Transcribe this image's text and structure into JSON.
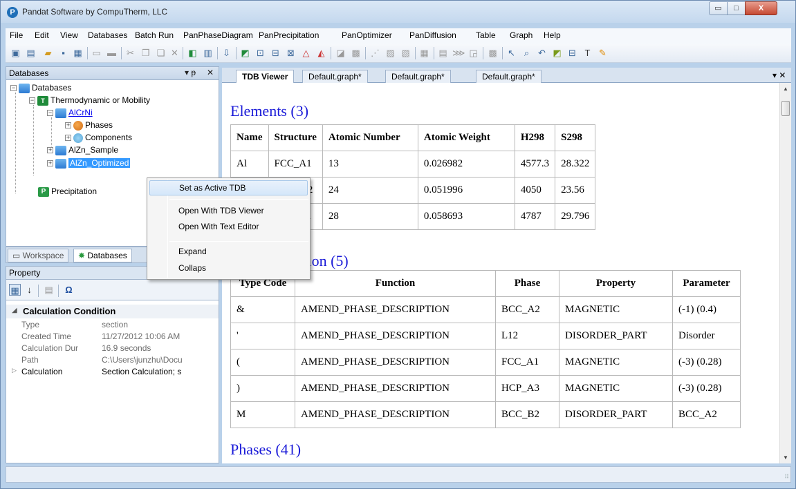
{
  "window": {
    "title": "Pandat Software by CompuTherm, LLC",
    "controls": {
      "minimize": "▭",
      "maximize": "□",
      "close": "X"
    }
  },
  "menu": [
    "File",
    "Edit",
    "View",
    "Databases",
    "Batch Run",
    "PanPhaseDiagram",
    "PanPrecipitation",
    "PanOptimizer",
    "PanDiffusion",
    "Table",
    "Graph",
    "Help"
  ],
  "databases_panel": {
    "title": "Databases",
    "pin": "▾ ᵽ",
    "close": "✕",
    "tree": {
      "root": "Databases",
      "thermo": "Thermodynamic or Mobility",
      "alcrni": "AlCrNi",
      "phases": "Phases",
      "components": "Components",
      "alzn_sample": "AlZn_Sample",
      "alzn_optimized": "AlZn_Optimized",
      "precipitation": "Precipitation"
    },
    "tabs": [
      "Workspace",
      "Databases"
    ]
  },
  "context_menu": {
    "items": [
      "Set as Active TDB",
      "Open With TDB Viewer",
      "Open With Text Editor",
      "Expand",
      "Collaps"
    ]
  },
  "property_panel": {
    "title": "Property",
    "category": "Calculation Condition",
    "rows": [
      {
        "name": "Type",
        "value": "section"
      },
      {
        "name": "Created Time",
        "value": "11/27/2012 10:06 AM"
      },
      {
        "name": "Calculation Dur",
        "value": "16.9 seconds"
      },
      {
        "name": "Path",
        "value": "C:\\Users\\junzhu\\Docu"
      },
      {
        "name": "Calculation",
        "value": "Section Calculation; s"
      }
    ]
  },
  "doc_tabs": [
    "TDB Viewer",
    "Default.graph*",
    "Default.graph*",
    "Default.graph*"
  ],
  "doc_tabs_menu": "▾ ✕",
  "elements": {
    "heading": "Elements (3)",
    "headers": [
      "Name",
      "Structure",
      "Atomic Number",
      "Atomic Weight",
      "H298",
      "S298"
    ],
    "rows": [
      [
        "Al",
        "FCC_A1",
        "13",
        "0.026982",
        "4577.3",
        "28.322"
      ],
      [
        "Cr",
        "BCC_A2",
        "24",
        "0.051996",
        "4050",
        "23.56"
      ],
      [
        "Ni",
        "FCC_A1",
        "28",
        "0.058693",
        "4787",
        "29.796"
      ]
    ]
  },
  "amend": {
    "heading": "Type Definition (5)",
    "headers": [
      "Type Code",
      "Function",
      "Phase",
      "Property",
      "Parameter"
    ],
    "rows": [
      [
        "&",
        "AMEND_PHASE_DESCRIPTION",
        "BCC_A2",
        "MAGNETIC",
        "(-1) (0.4)"
      ],
      [
        "'",
        "AMEND_PHASE_DESCRIPTION",
        "L12",
        "DISORDER_PART",
        "Disorder"
      ],
      [
        "(",
        "AMEND_PHASE_DESCRIPTION",
        "FCC_A1",
        "MAGNETIC",
        "(-3) (0.28)"
      ],
      [
        ")",
        "AMEND_PHASE_DESCRIPTION",
        "HCP_A3",
        "MAGNETIC",
        "(-3) (0.28)"
      ],
      [
        "M",
        "AMEND_PHASE_DESCRIPTION",
        "BCC_B2",
        "DISORDER_PART",
        "BCC_A2"
      ]
    ]
  },
  "phases_heading": "Phases (41)",
  "colors": {
    "accent": "#3399ff",
    "heading_blue": "#1b1bd8",
    "link": "#0000ee"
  }
}
